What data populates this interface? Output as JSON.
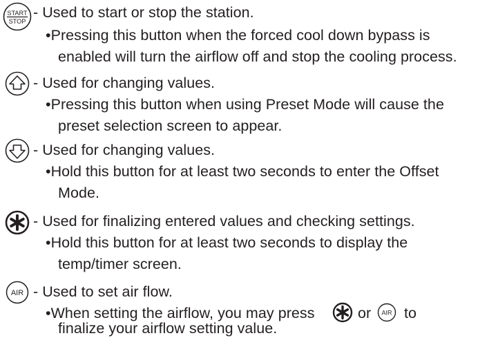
{
  "buttons": [
    {
      "icon": "start-stop-icon",
      "icon_label_top": "START",
      "icon_label_bottom": "STOP",
      "description": "- Used to start or stop the station.",
      "notes": [
        "•Pressing this button when the forced cool down bypass is",
        "enabled will turn the airflow off and stop the cooling process."
      ]
    },
    {
      "icon": "up-arrow-icon",
      "description": "- Used for changing values.",
      "notes": [
        "•Pressing this button when using Preset Mode will cause the",
        "preset selection screen to appear."
      ]
    },
    {
      "icon": "down-arrow-icon",
      "description": "- Used for changing values.",
      "notes": [
        "•Hold this button for at least two seconds to enter the Offset",
        "Mode."
      ]
    },
    {
      "icon": "asterisk-icon",
      "description": "- Used for finalizing entered values and checking settings.",
      "notes": [
        "•Hold this button for at least two seconds to display the",
        "temp/timer screen."
      ]
    },
    {
      "icon": "air-icon",
      "icon_label": "AIR",
      "description": "- Used to set air flow.",
      "notes_inline": {
        "before": "•When setting the airflow, you may press",
        "between": "or",
        "after": "to"
      },
      "notes": [
        "finalize your airflow setting value."
      ]
    }
  ]
}
